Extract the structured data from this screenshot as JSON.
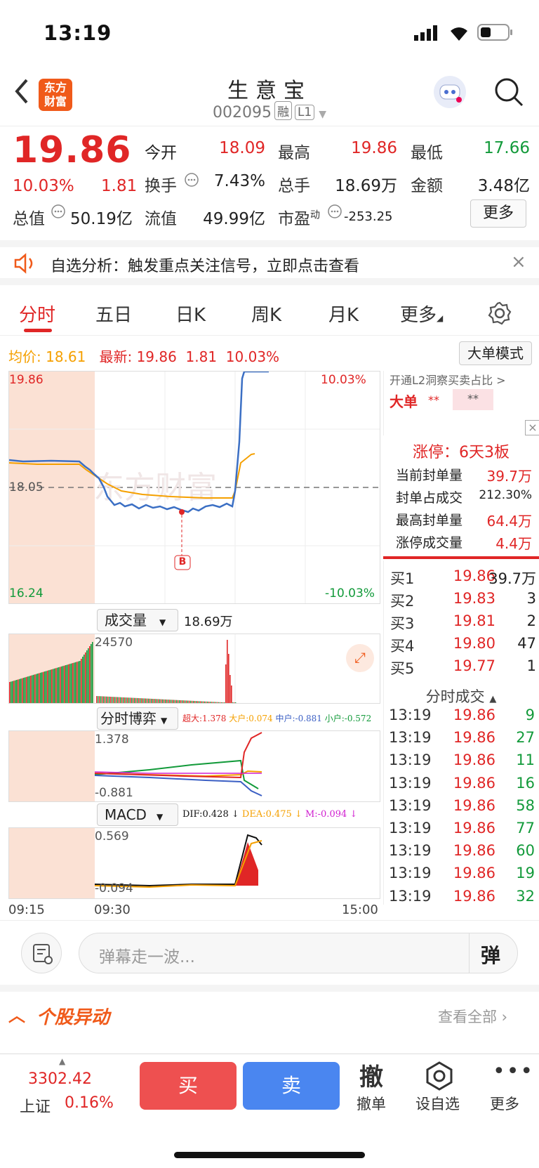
{
  "status": {
    "time": "13:19"
  },
  "header": {
    "title": "生意宝",
    "code": "002095",
    "tag1": "融",
    "tag2": "L1",
    "logo_line1": "东方",
    "logo_line2": "财富"
  },
  "quote": {
    "price": "19.86",
    "pct": "10.03%",
    "change": "1.81",
    "open_lbl": "今开",
    "open": "18.09",
    "high_lbl": "最高",
    "high": "19.86",
    "low_lbl": "最低",
    "low": "17.66",
    "turnover_lbl": "换手",
    "turnover": "7.43%",
    "vol_lbl": "总手",
    "vol": "18.69万",
    "amount_lbl": "金额",
    "amount": "3.48亿",
    "mcap_lbl": "总值",
    "mcap": "50.19亿",
    "float_lbl": "流值",
    "float": "49.99亿",
    "pe_lbl": "市盈",
    "pe_sup": "动",
    "pe": "-253.25",
    "more": "更多"
  },
  "notice": {
    "text": "自选分析：触发重点关注信号，立即点击查看"
  },
  "tabs": [
    "分时",
    "五日",
    "日K",
    "周K",
    "月K",
    "更多"
  ],
  "infobar": {
    "avg_lbl": "均价:",
    "avg": "18.61",
    "latest_lbl": "最新:",
    "latest": "19.86",
    "chg": "1.81",
    "pct": "10.03%",
    "mode": "大单模式"
  },
  "chart": {
    "ymax": "19.86",
    "ymid": "18.05",
    "ymin": "16.24",
    "pmax": "10.03%",
    "pmin": "-10.03%",
    "marker": "B",
    "vol_title": "成交量",
    "vol_total": "18.69万",
    "vol_max": "24570",
    "game_title": "分时博弈",
    "game_legend": [
      {
        "t": "超大:1.378",
        "c": "#e02626"
      },
      {
        "t": "大户:0.074",
        "c": "#f5a000"
      },
      {
        "t": "中户:-0.881",
        "c": "#3b5fc4"
      },
      {
        "t": "小户:-0.572",
        "c": "#129a3a"
      }
    ],
    "game_max": "1.378",
    "game_min": "-0.881",
    "macd_title": "MACD",
    "macd_legend": [
      {
        "t": "DIF:0.428 ↓",
        "c": "#111"
      },
      {
        "t": "DEA:0.475 ↓",
        "c": "#f5a000"
      },
      {
        "t": "M:-0.094 ↓",
        "c": "#d020d0"
      }
    ],
    "macd_max": "0.569",
    "macd_min": "-0.094",
    "t0": "09:15",
    "t1": "09:30",
    "t2": "15:00"
  },
  "side": {
    "l2": "开通L2洞察买卖占比 >",
    "big": "大单",
    "big_v1": "**",
    "big_v2": "**",
    "limit_title": "涨停：6天3板",
    "limit_rows": [
      {
        "k": "当前封单量",
        "v": "39.7万"
      },
      {
        "k": "封单占成交",
        "v": "212.30%"
      },
      {
        "k": "最高封单量",
        "v": "64.4万"
      },
      {
        "k": "涨停成交量",
        "v": "4.4万"
      }
    ]
  },
  "bids": [
    {
      "k": "买1",
      "p": "19.86",
      "q": "39.7万"
    },
    {
      "k": "买2",
      "p": "19.83",
      "q": "3"
    },
    {
      "k": "买3",
      "p": "19.81",
      "q": "2"
    },
    {
      "k": "买4",
      "p": "19.80",
      "q": "47"
    },
    {
      "k": "买5",
      "p": "19.77",
      "q": "1"
    }
  ],
  "trades_title": "分时成交",
  "trades": [
    {
      "t": "13:19",
      "p": "19.86",
      "q": "9"
    },
    {
      "t": "13:19",
      "p": "19.86",
      "q": "27"
    },
    {
      "t": "13:19",
      "p": "19.86",
      "q": "11"
    },
    {
      "t": "13:19",
      "p": "19.86",
      "q": "16"
    },
    {
      "t": "13:19",
      "p": "19.86",
      "q": "58"
    },
    {
      "t": "13:19",
      "p": "19.86",
      "q": "77"
    },
    {
      "t": "13:19",
      "p": "19.86",
      "q": "60"
    },
    {
      "t": "13:19",
      "p": "19.86",
      "q": "19"
    },
    {
      "t": "13:19",
      "p": "19.86",
      "q": "32"
    }
  ],
  "danmu": {
    "placeholder": "弹幕走一波...",
    "btn": "弹"
  },
  "section": {
    "title": "个股异动",
    "more": "查看全部"
  },
  "bottom": {
    "index": "3302.42",
    "index_name": "上证",
    "index_pct": "0.16%",
    "buy": "买",
    "sell": "卖",
    "cancel_icon": "撤",
    "cancel": "撤单",
    "fav": "设自选",
    "more": "更多"
  }
}
